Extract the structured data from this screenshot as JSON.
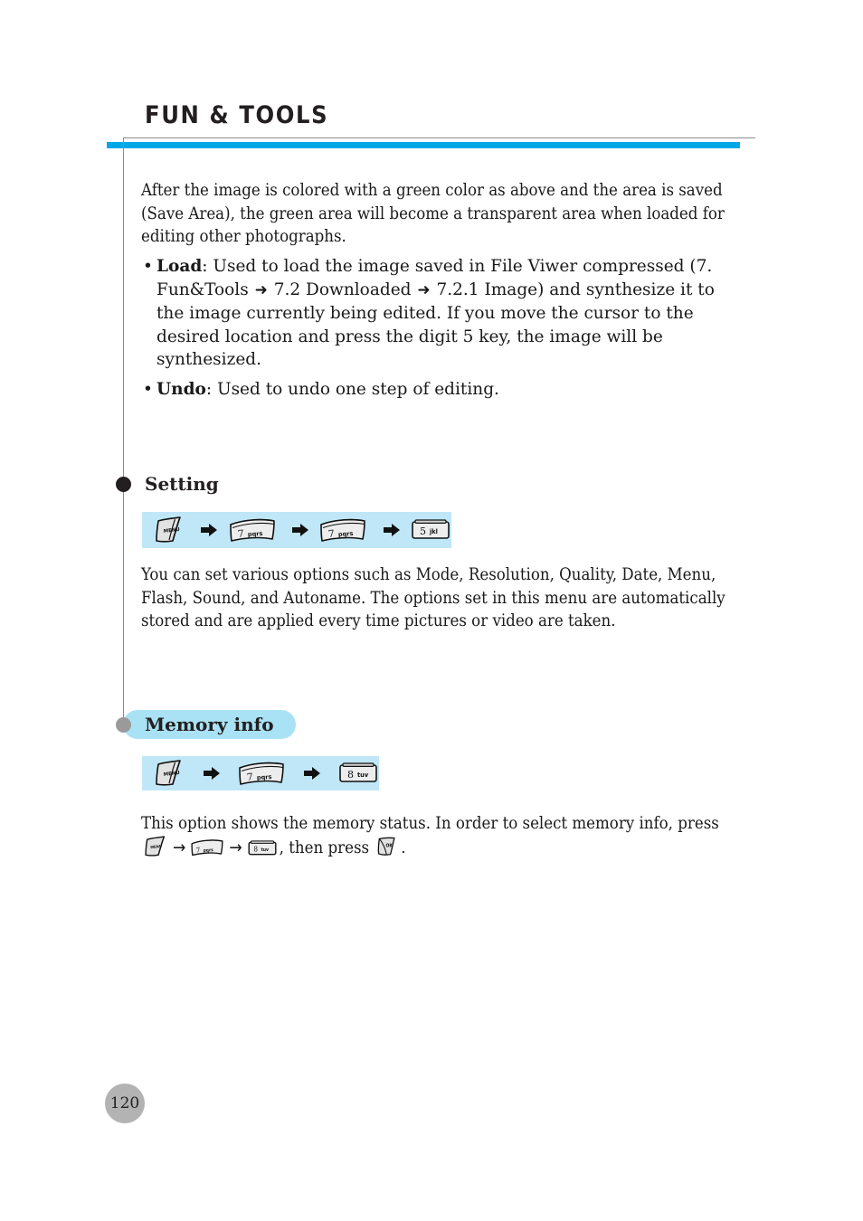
{
  "document": {
    "chapter_title": "FUN & TOOLS",
    "page_number": "120",
    "accent_blue": "#00a8e8",
    "strip_blue": "#bfe7f7",
    "pill_blue": "#a9e2f5",
    "rule_gray": "#8c8c8c"
  },
  "intro": {
    "paragraph": "After the image is colored with a green color as above and the area is saved (Save Area), the green area will become a transparent area when loaded for editing other photographs."
  },
  "bullets": [
    {
      "marker": "•",
      "term": "Load",
      "text_1": ": Used to load the image saved in File Viwer compressed (7. Fun&Tools ",
      "arrow_1": "➜",
      "text_2": " 7.2 Downloaded ",
      "arrow_2": "➜",
      "text_3": " 7.2.1 Image) and synthesize it to the image currently being edited. If you move the cursor to the desired location and press the digit 5 key, the image will be synthesized."
    },
    {
      "marker": "•",
      "term": "Undo",
      "text_1": ": Used to undo one step of editing.",
      "arrow_1": "",
      "text_2": "",
      "arrow_2": "",
      "text_3": ""
    }
  ],
  "setting_section": {
    "heading": "Setting",
    "keys": [
      {
        "type": "menu",
        "label": "MENU"
      },
      {
        "type": "arrow",
        "label": "arrow-right"
      },
      {
        "type": "num-curved",
        "digit": "7",
        "letters": "pqrs"
      },
      {
        "type": "arrow",
        "label": "arrow-right"
      },
      {
        "type": "num-curved",
        "digit": "7",
        "letters": "pqrs"
      },
      {
        "type": "arrow",
        "label": "arrow-right"
      },
      {
        "type": "num-flat",
        "digit": "5",
        "letters": "jkl"
      }
    ],
    "paragraph": "You can set various options such as Mode, Resolution, Quality, Date, Menu, Flash, Sound, and Autoname. The options set in this menu are automatically stored and are applied every time pictures or video are taken."
  },
  "memory_section": {
    "heading": "Memory info",
    "keys": [
      {
        "type": "menu",
        "label": "MENU"
      },
      {
        "type": "arrow",
        "label": "arrow-right"
      },
      {
        "type": "num-curved",
        "digit": "7",
        "letters": "pqrs"
      },
      {
        "type": "arrow",
        "label": "arrow-right"
      },
      {
        "type": "num-flat",
        "digit": "8",
        "letters": "tuv"
      }
    ],
    "paragraph_part_1": "This option shows the memory status. In order to select memory info, press ",
    "arrow_1": "→",
    "arrow_2": "→",
    "paragraph_part_2": ", then press ",
    "paragraph_part_3": ".",
    "inline_keys": {
      "menu": "MENU",
      "seven_digit": "7",
      "seven_letters": "pqrs",
      "eight_digit": "8",
      "eight_letters": "tuv",
      "ok": "OK"
    }
  }
}
